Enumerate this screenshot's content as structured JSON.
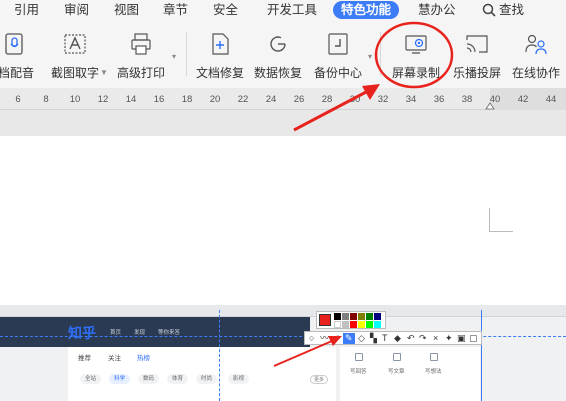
{
  "menu": {
    "tabs": [
      "引用",
      "审阅",
      "视图",
      "章节",
      "安全",
      "开发工具",
      "特色功能",
      "慧办公"
    ],
    "active_tab": "特色功能",
    "search_label": "查找"
  },
  "ribbon": {
    "tools": [
      {
        "label": "档配音",
        "icon": "microphone-icon"
      },
      {
        "label": "截图取字",
        "icon": "screenshot-text-icon"
      },
      {
        "label": "高级打印",
        "icon": "printer-icon"
      },
      {
        "label": "文档修复",
        "icon": "document-repair-icon"
      },
      {
        "label": "数据恢复",
        "icon": "data-recovery-icon"
      },
      {
        "label": "备份中心",
        "icon": "backup-icon"
      },
      {
        "label": "屏幕录制",
        "icon": "screen-record-icon"
      },
      {
        "label": "乐播投屏",
        "icon": "cast-screen-icon"
      },
      {
        "label": "在线协作",
        "icon": "collaboration-icon"
      }
    ]
  },
  "ruler": {
    "ticks": [
      "6",
      "8",
      "10",
      "12",
      "14",
      "16",
      "18",
      "20",
      "22",
      "24",
      "26",
      "28",
      "30",
      "32",
      "34",
      "36",
      "38",
      "40",
      "42",
      "44"
    ]
  },
  "embedded": {
    "logo": "知乎",
    "nav": [
      "首页",
      "发现",
      "等你来答"
    ],
    "tabs": [
      "推荐",
      "关注",
      "热榜"
    ],
    "pills": [
      "全站",
      "科学",
      "数码",
      "体育",
      "时尚",
      "影视"
    ],
    "selected_pill": "科学",
    "more_button": "更多",
    "right_items": [
      "写回答",
      "写文章",
      "写想法"
    ]
  },
  "colors": {
    "accent": "#3c7cf6",
    "annotation_red": "#e8231d",
    "zhihu_blue": "#2d6ff7"
  }
}
